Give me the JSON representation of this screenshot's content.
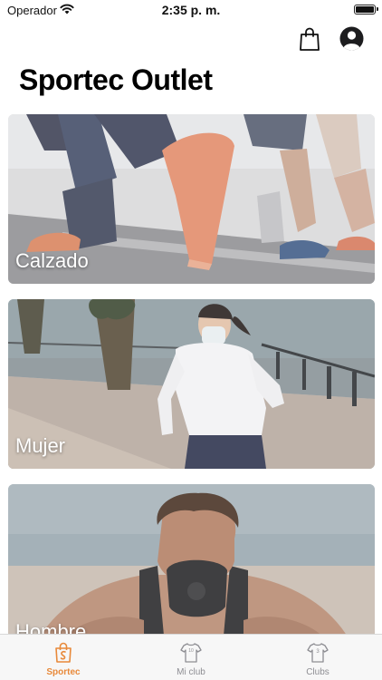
{
  "status_bar": {
    "carrier": "Operador",
    "time": "2:35 p. m."
  },
  "header": {
    "title": "Sportec Outlet",
    "cart_icon": "shopping-bag-icon",
    "profile_icon": "account-circle-icon"
  },
  "categories": [
    {
      "label": "Calzado"
    },
    {
      "label": "Mujer"
    },
    {
      "label": "Hombre"
    }
  ],
  "tab_bar": {
    "active_color": "#e8893a",
    "inactive_color": "#8e8e93",
    "tabs": [
      {
        "label": "Sportec",
        "icon": "shopping-bag-tab-icon",
        "active": true
      },
      {
        "label": "Mi club",
        "icon": "jersey-icon",
        "active": false
      },
      {
        "label": "Clubs",
        "icon": "jersey-icon",
        "active": false
      }
    ]
  }
}
